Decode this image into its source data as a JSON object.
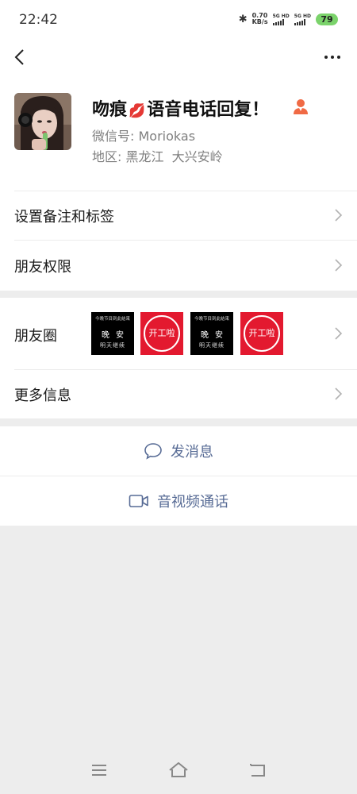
{
  "status_bar": {
    "time": "22:42",
    "net_speed_value": "0.70",
    "net_speed_unit": "KB/s",
    "signal1": "5G HD",
    "signal2": "5G HD",
    "battery": "79",
    "battery_color": "#7bd36b"
  },
  "nav": {
    "back_icon": "chevron-left-icon",
    "more_icon": "more-dots-icon"
  },
  "profile": {
    "name_part1": "吻痕",
    "name_emoji": "💋",
    "name_part2": "语音电话回复！",
    "wechat_id_label": "微信号:",
    "wechat_id": "Moriokas",
    "region_label": "地区:",
    "region": "黑龙江  大兴安岭"
  },
  "menu": {
    "remark_tags": "设置备注和标签",
    "friend_permissions": "朋友权限",
    "moments": "朋友圈",
    "more_info": "更多信息"
  },
  "moments_thumbs": [
    {
      "type": "black",
      "line1": "今晚节目到此结束",
      "line2": "晚安",
      "line3": "明天继续"
    },
    {
      "type": "red",
      "text": "开工啦"
    },
    {
      "type": "black",
      "line1": "今晚节目到此结束",
      "line2": "晚安",
      "line3": "明天继续"
    },
    {
      "type": "red",
      "text": "开工啦"
    }
  ],
  "actions": {
    "send_message": "发消息",
    "video_call": "音视频通话",
    "link_color": "#576b95"
  }
}
